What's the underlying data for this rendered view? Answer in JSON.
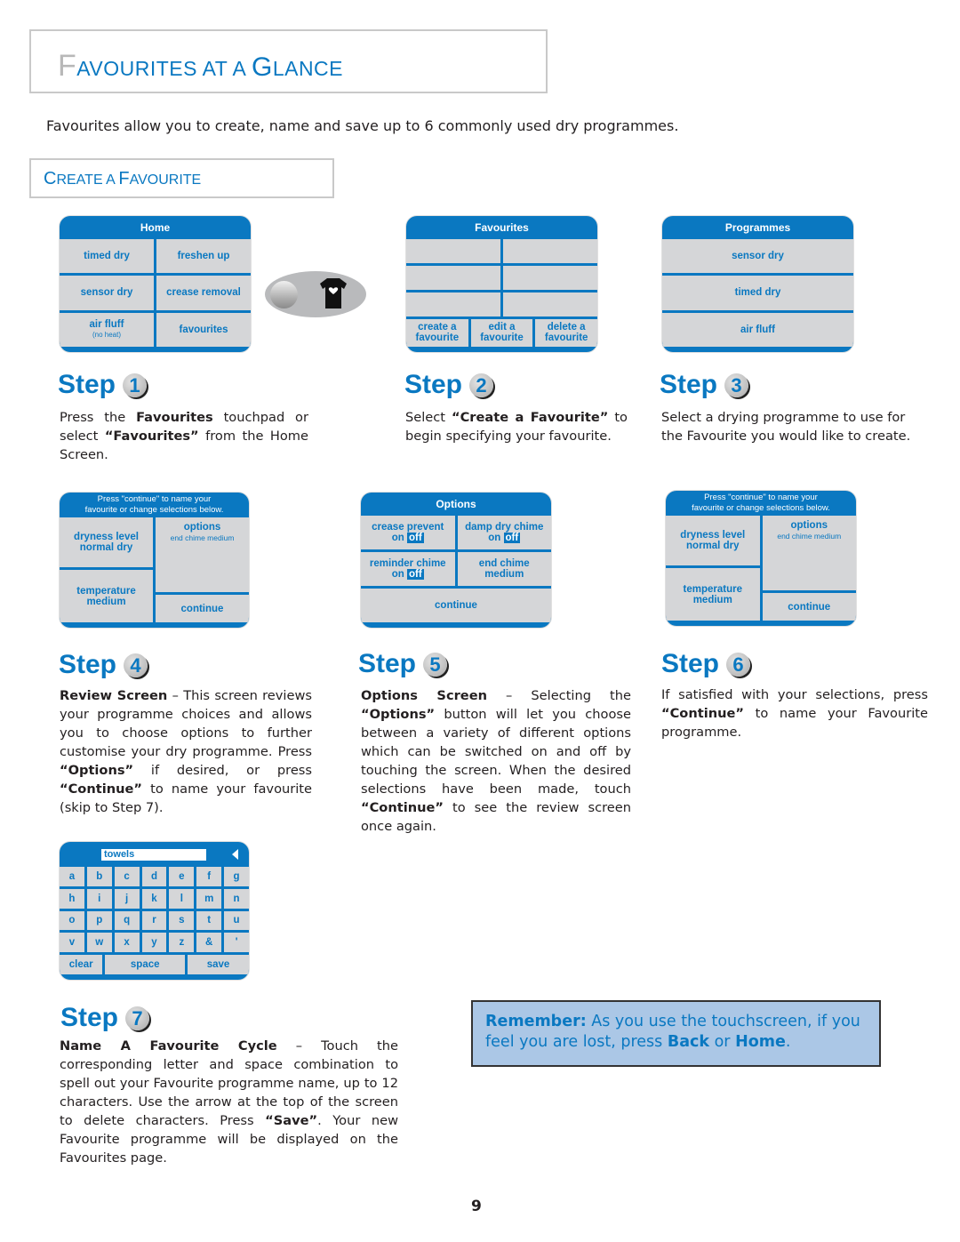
{
  "header": {
    "title_cap1": "F",
    "title_rest1": "AVOURITES AT A ",
    "title_cap2": "G",
    "title_rest2": "LANCE",
    "intro": "Favourites allow you to create, name and save up to 6 commonly used dry programmes."
  },
  "section": {
    "cap1": "C",
    "rest1": "REATE A ",
    "cap2": "F",
    "rest2": "AVOURITE"
  },
  "colors": {
    "accent": "#0a78c1",
    "screen_cell": "#d5d6d8",
    "remember_bg": "#abc7e6"
  },
  "screens": {
    "home": {
      "title": "Home",
      "buttons": [
        "timed dry",
        "freshen up",
        "sensor dry",
        "crease removal",
        "air fluff",
        "favourites"
      ],
      "air_fluff_note": "(no heat)"
    },
    "favourites_touchpad": {
      "icon": "shirt-heart-icon"
    },
    "favourites": {
      "title": "Favourites",
      "actions": [
        {
          "line1": "create a",
          "line2": "favourite"
        },
        {
          "line1": "edit a",
          "line2": "favourite"
        },
        {
          "line1": "delete a",
          "line2": "favourite"
        }
      ]
    },
    "programmes": {
      "title": "Programmes",
      "items": [
        "sensor dry",
        "timed dry",
        "air fluff"
      ]
    },
    "review": {
      "title_line1": "Press \"continue\" to name your",
      "title_line2": "favourite or change selections below.",
      "dryness_label": "dryness level",
      "dryness_value": "normal dry",
      "options_label": "options",
      "options_value": "end chime medium",
      "temp_label": "temperature",
      "temp_value": "medium",
      "continue": "continue"
    },
    "options": {
      "title": "Options",
      "items": [
        {
          "label": "crease prevent",
          "on": "on",
          "off": "off"
        },
        {
          "label": "damp dry chime",
          "on": "on",
          "off": "off"
        },
        {
          "label": "reminder chime",
          "on": "on",
          "off": "off"
        },
        {
          "label": "end chime",
          "value": "medium"
        }
      ],
      "continue": "continue"
    },
    "keyboard": {
      "input_value": "towels",
      "rows": [
        [
          "a",
          "b",
          "c",
          "d",
          "e",
          "f",
          "g"
        ],
        [
          "h",
          "i",
          "j",
          "k",
          "l",
          "m",
          "n"
        ],
        [
          "o",
          "p",
          "q",
          "r",
          "s",
          "t",
          "u"
        ],
        [
          "v",
          "w",
          "x",
          "y",
          "z",
          "&",
          "'"
        ]
      ],
      "clear": "clear",
      "space": "space",
      "save": "save"
    }
  },
  "steps": [
    {
      "label": "Step",
      "num": "1",
      "text_html": "Press the <b>Favourites</b> touchpad or select <b>“Favourites”</b> from the Home Screen."
    },
    {
      "label": "Step",
      "num": "2",
      "text_html": "Select <b>“Create a Favourite”</b> to begin specifying your favourite."
    },
    {
      "label": "Step",
      "num": "3",
      "text_html": "Select a drying programme to use for the Favourite you would like to create."
    },
    {
      "label": "Step",
      "num": "4",
      "text_html": "<b>Review Screen</b> – This screen reviews your programme choices and allows you to choose options to further customise your dry programme. Press <b>“Options”</b> if desired, or press <b>“Continue”</b> to name your favourite (skip to Step 7)."
    },
    {
      "label": "Step",
      "num": "5",
      "text_html": "<b>Options Screen</b> – Selecting the <b>“Options”</b> button will let you choose between a variety of different options which can be switched on and off by touching the screen. When the desired selections have been made, touch <b>“Continue”</b> to see the review screen once again."
    },
    {
      "label": "Step",
      "num": "6",
      "text_html": "If satisfied with your selections, press <b>“Continue”</b> to name your Favourite programme."
    },
    {
      "label": "Step",
      "num": "7",
      "text_html": "<b>Name A Favourite Cycle</b> – Touch the corresponding letter and space combination to spell out your Favourite programme name, up to 12 characters. Use the arrow at the top of the screen to delete characters. Press <b>“Save”</b>. Your new Favourite programme will be displayed on the Favourites page."
    }
  ],
  "remember": {
    "label": "Remember:",
    "text1": " As you use the touchscreen, if you feel you are lost, press ",
    "back": "Back",
    "or": " or ",
    "home": "Home",
    "end": "."
  },
  "page_number": "9"
}
